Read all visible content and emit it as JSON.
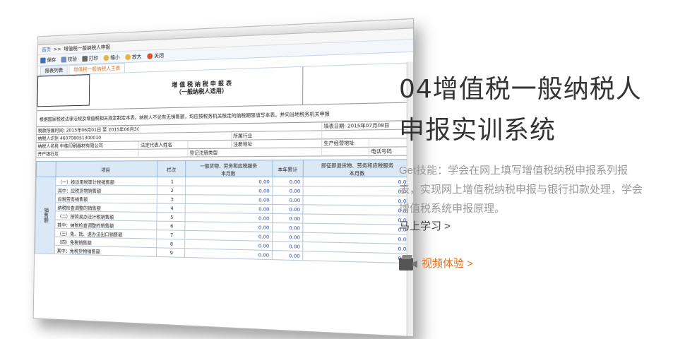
{
  "screenshot": {
    "breadcrumb_home": "首页",
    "breadcrumb_sep": ">>",
    "breadcrumb_page": "增值税一般纳税人申报",
    "toolbar": [
      "保存",
      "校验",
      "打印",
      "缩小",
      "放大",
      "关闭"
    ],
    "tabs": [
      "报表列表",
      "增值税一般纳税人主表"
    ],
    "form_title_1": "增 值 税 纳 税 申 报 表",
    "form_title_2": "（一般纳税人适用）",
    "notice": "根据国家税收法律法规及增值税相关规定制定本表。纳税人不论有无销售额，均应按税务机关核定的纳税期限填写本表，并向当地税务机关申报",
    "info": {
      "period_label": "税款所属时间:",
      "period_value": "2015年06月01日 至 2015年06月30日",
      "fill_date": "填表日期: 2015年07月08日",
      "taxpayer_id_label": "纳税人识别号",
      "taxpayer_id_value": "460708051300010",
      "industry_label": "所属行业",
      "name_label": "纳税人名称",
      "name_value": "中桂印刷器材有限公司",
      "legal_rep_label": "法定代表人姓名",
      "reg_addr_label": "注册地址",
      "biz_addr_label": "生产经营地址",
      "bank_label": "开户银行及账号",
      "reg_type_label": "登记注册类型",
      "phone_label": "电话号码"
    },
    "table": {
      "col_item": "项目",
      "col_no": "栏次",
      "col_general": "一般货物、劳务和应税服务",
      "col_month": "本月数",
      "col_year": "本年累计",
      "col_refund": "即征即退货物、劳务和应税服务",
      "col_refund_month": "本月数",
      "side_label": "销售额",
      "rows": [
        {
          "item": "（一）按适用税率计税销售额",
          "no": "1",
          "v1": "0.00",
          "v2": "0.00",
          "v3": "0.00"
        },
        {
          "item": "其中：应税货物销售额",
          "no": "2",
          "v1": "0.00",
          "v2": "0.00",
          "v3": "0.00"
        },
        {
          "item": "应税劳务销售额",
          "no": "3",
          "v1": "0.00",
          "v2": "0.00",
          "v3": "0.00"
        },
        {
          "item": "纳税检查调整的销售额",
          "no": "4",
          "v1": "0.00",
          "v2": "0.00",
          "v3": "0.00"
        },
        {
          "item": "（二）按简易办法计税销售额",
          "no": "5",
          "v1": "0.00",
          "v2": "0.00",
          "v3": "0.00"
        },
        {
          "item": "其中：纳税检查调整的销售额",
          "no": "6",
          "v1": "0.00",
          "v2": "0.00",
          "v3": "0.00"
        },
        {
          "item": "（三）免、抵、退办法出口销售额",
          "no": "7",
          "v1": "0.00",
          "v2": "0.00",
          "v3": "0.00"
        },
        {
          "item": "（四）免税销售额",
          "no": "8",
          "v1": "0.00",
          "v2": "0.00",
          "v3": "0.00"
        },
        {
          "item": "其中：免税货物销售额",
          "no": "9",
          "v1": "0.00",
          "v2": "0.00",
          "v3": "0.00"
        }
      ]
    }
  },
  "info": {
    "title_line1": "04增值税一般纳税人",
    "title_line2": "申报实训系统",
    "description": "Get技能：学会在网上填写增值税纳税申报系列报表，实现网上增值税纳税申报与银行扣款处理，学会增值税系统申报原理。",
    "learn_link": "马上学习 >",
    "video_link": "视频体验 >",
    "colors": {
      "title": "#333333",
      "desc": "#999999",
      "accent": "#e07020"
    }
  }
}
